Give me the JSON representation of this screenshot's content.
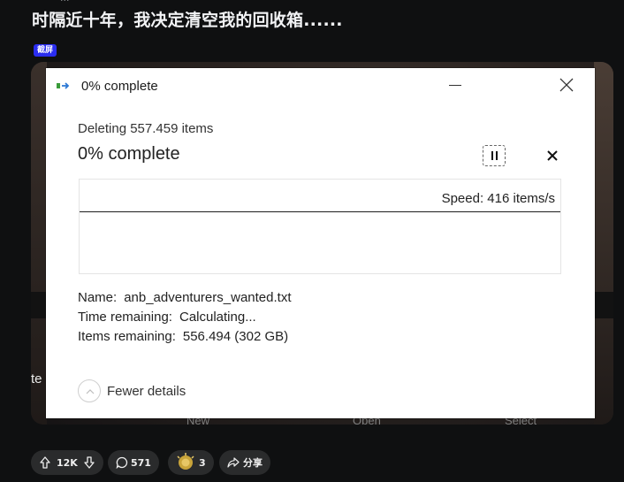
{
  "post": {
    "title": "时隔近十年，我决定清空我的回收箱......",
    "flair": "截屏"
  },
  "background": {
    "left_fragment": "te",
    "labels": [
      "New",
      "Open",
      "Select"
    ]
  },
  "dialog": {
    "title": "0% complete",
    "operation": "Deleting 557.459 items",
    "percent_text": "0% complete",
    "percent_value": 0,
    "speed": "Speed: 416 items/s",
    "details": [
      {
        "key": "Name:",
        "value": "anb_adventurers_wanted.txt"
      },
      {
        "key": "Time remaining:",
        "value": "Calculating..."
      },
      {
        "key": "Items remaining:",
        "value": "556.494 (302 GB)"
      }
    ],
    "fewer_details": "Fewer details",
    "icons": {
      "app": "file-transfer-icon",
      "minimize": "minimize-icon",
      "close": "close-icon",
      "pause": "pause-icon",
      "cancel": "cancel-icon",
      "collapse": "chevron-up-icon"
    }
  },
  "actions": {
    "upvotes": "12K",
    "comments": "571",
    "awards": "3",
    "share": "分享"
  },
  "colors": {
    "page_bg": "#0f1011",
    "flair_bg": "#2a2df0",
    "pill_bg": "#2a2b2c",
    "dialog_bg": "#ffffff",
    "progress_track": "#eaf5e7"
  }
}
